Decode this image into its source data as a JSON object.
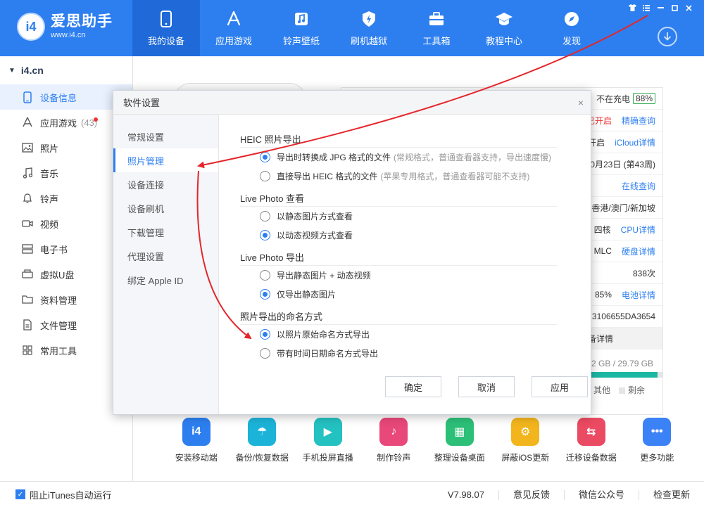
{
  "brand": {
    "logo_badge": "i4",
    "name": "爱思助手",
    "url": "www.i4.cn"
  },
  "nav": [
    {
      "label": "我的设备",
      "icon": "phone-icon"
    },
    {
      "label": "应用游戏",
      "icon": "app-store-icon"
    },
    {
      "label": "铃声壁纸",
      "icon": "music-icon"
    },
    {
      "label": "刷机越狱",
      "icon": "flash-icon"
    },
    {
      "label": "工具箱",
      "icon": "toolbox-icon"
    },
    {
      "label": "教程中心",
      "icon": "graduation-cap-icon"
    },
    {
      "label": "发现",
      "icon": "compass-icon"
    }
  ],
  "sidebar": {
    "device_name": "i4.cn",
    "items": [
      {
        "label": "设备信息",
        "icon": "device-info-icon"
      },
      {
        "label": "应用游戏",
        "icon": "app-icon",
        "count": "(43)"
      },
      {
        "label": "照片",
        "icon": "photo-icon"
      },
      {
        "label": "音乐",
        "icon": "music-note-icon"
      },
      {
        "label": "铃声",
        "icon": "bell-icon"
      },
      {
        "label": "视频",
        "icon": "video-icon"
      },
      {
        "label": "电子书",
        "icon": "ebook-icon"
      },
      {
        "label": "虚拟U盘",
        "icon": "usb-icon"
      },
      {
        "label": "资料管理",
        "icon": "folder-icon"
      },
      {
        "label": "文件管理",
        "icon": "file-icon"
      },
      {
        "label": "常用工具",
        "icon": "grid-icon"
      }
    ]
  },
  "info": {
    "rows": [
      {
        "value": "不在充电",
        "battery": "88%"
      },
      {
        "value": "已开启",
        "link": "精确查询"
      },
      {
        "value": "开启",
        "link": "iCloud详情"
      },
      {
        "value": "0月23日 (第43周)"
      },
      {
        "link": "在线查询"
      },
      {
        "value": "香港/澳门/新加坡"
      },
      {
        "value": "0 四核",
        "link": "CPU详情"
      },
      {
        "value": "MLC",
        "link": "硬盘详情"
      },
      {
        "value": "838次"
      },
      {
        "value": "85%",
        "link": "电池详情"
      },
      {
        "value": "3106655DA3654"
      }
    ],
    "detail_row": "备详情",
    "storage": ".82 GB / 29.79 GB",
    "storage_fraction": 0.93,
    "legend": [
      "其他",
      "剩余"
    ]
  },
  "tools": [
    {
      "label": "安装移动端",
      "glyph": "i4",
      "color": "#2d7ff0"
    },
    {
      "label": "备份/恢复数据",
      "glyph": "☂",
      "color": "#1cb3d8"
    },
    {
      "label": "手机投屏直播",
      "glyph": "▶",
      "color": "#24c1c1"
    },
    {
      "label": "制作铃声",
      "glyph": "♪",
      "color": "#e8487a"
    },
    {
      "label": "整理设备桌面",
      "glyph": "▦",
      "color": "#2cbf78"
    },
    {
      "label": "屏蔽iOS更新",
      "glyph": "⚙",
      "color": "#f2b51d"
    },
    {
      "label": "迁移设备数据",
      "glyph": "⇆",
      "color": "#ea4a62"
    },
    {
      "label": "更多功能",
      "glyph": "•••",
      "color": "#3b82f6"
    }
  ],
  "status": {
    "checkbox_label": "阻止iTunes自动运行",
    "version": "V7.98.07",
    "feedback": "意见反馈",
    "wechat": "微信公众号",
    "update": "检查更新"
  },
  "dialog": {
    "title": "软件设置",
    "close": "×",
    "tabs": [
      "常规设置",
      "照片管理",
      "设备连接",
      "设备刷机",
      "下载管理",
      "代理设置",
      "绑定 Apple ID"
    ],
    "sections": [
      {
        "title": "HEIC 照片导出",
        "options": [
          {
            "label": "导出时转换成 JPG 格式的文件",
            "hint": "(常规格式，普通查看器支持，导出速度慢)",
            "checked": true
          },
          {
            "label": "直接导出 HEIC 格式的文件",
            "hint": "(苹果专用格式，普通查看器可能不支持)",
            "checked": false
          }
        ]
      },
      {
        "title": "Live Photo 查看",
        "options": [
          {
            "label": "以静态图片方式查看",
            "checked": false
          },
          {
            "label": "以动态视频方式查看",
            "checked": true
          }
        ]
      },
      {
        "title": "Live Photo 导出",
        "options": [
          {
            "label": "导出静态图片 + 动态视频",
            "checked": false
          },
          {
            "label": "仅导出静态图片",
            "checked": true
          }
        ]
      },
      {
        "title": "照片导出的命名方式",
        "options": [
          {
            "label": "以照片原始命名方式导出",
            "checked": true
          },
          {
            "label": "带有时间日期命名方式导出",
            "checked": false
          }
        ]
      }
    ],
    "buttons": {
      "ok": "确定",
      "cancel": "取消",
      "apply": "应用"
    }
  },
  "colors": {
    "accent": "#2d7ff0",
    "annotation_arrow": "#e5262b"
  }
}
